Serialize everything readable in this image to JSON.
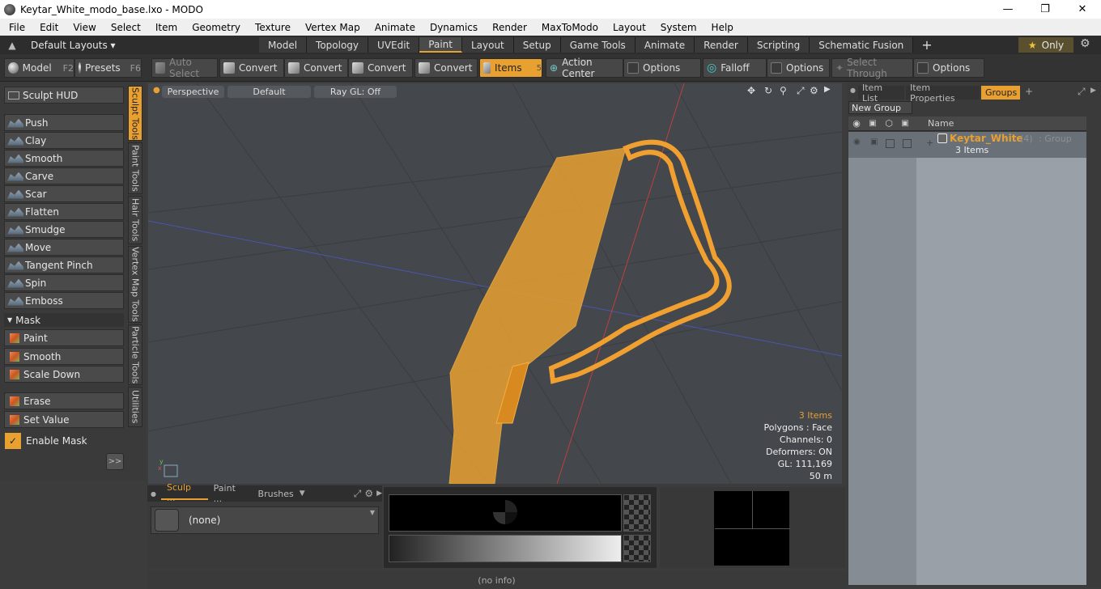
{
  "window": {
    "title": "Keytar_White_modo_base.lxo - MODO"
  },
  "menu": [
    "File",
    "Edit",
    "View",
    "Select",
    "Item",
    "Geometry",
    "Texture",
    "Vertex Map",
    "Animate",
    "Dynamics",
    "Render",
    "MaxToModo",
    "Layout",
    "System",
    "Help"
  ],
  "modebar": {
    "layouts_label": "Default Layouts ▾",
    "tabs": [
      "Model",
      "Topology",
      "UVEdit",
      "Paint",
      "Layout",
      "Setup",
      "Game Tools",
      "Animate",
      "Render",
      "Scripting",
      "Schematic Fusion"
    ],
    "active_tab": "Paint",
    "add": "+",
    "only_label": "Only",
    "star": "★"
  },
  "toolbar": {
    "model": "Model",
    "model_key": "F2",
    "presets": "Presets",
    "presets_key": "F6",
    "auto_select": "Auto Select",
    "convert1": "Convert",
    "convert2": "Convert",
    "convert3": "Convert",
    "convert4": "Convert",
    "items": "Items",
    "items_key": "5",
    "action_center": "Action Center",
    "options1": "Options",
    "falloff": "Falloff",
    "options2": "Options",
    "select_through": "Select Through",
    "options3": "Options"
  },
  "left": {
    "sculpt_hud": "Sculpt HUD",
    "tools": [
      "Push",
      "Clay",
      "Smooth",
      "Carve",
      "Scar",
      "Flatten",
      "Smudge",
      "Move",
      "Tangent Pinch",
      "Spin",
      "Emboss"
    ],
    "mask_label": "Mask",
    "mask_tools": [
      "Paint",
      "Smooth",
      "Scale Down"
    ],
    "erase": "Erase",
    "set_value": "Set Value",
    "enable_mask": "Enable Mask",
    "more": ">>",
    "vtabs": [
      "Sculpt Tools",
      "Paint Tools",
      "Hair Tools",
      "Vertex Map Tools",
      "Particle Tools",
      "Utilities"
    ]
  },
  "viewport": {
    "view": "Perspective",
    "shading": "Default",
    "raygl": "Ray GL: Off",
    "info": {
      "items": "3 Items",
      "polygons": "Polygons : Face",
      "channels": "Channels: 0",
      "deformers": "Deformers: ON",
      "gl": "GL: 111,169",
      "scale": "50 m"
    }
  },
  "bottom": {
    "tabs": [
      "Sculp ...",
      "Paint ...",
      "Brushes"
    ],
    "preset": "(none)"
  },
  "right": {
    "tabs": [
      "Item List",
      "Item Properties",
      "Groups"
    ],
    "active_tab": "Groups",
    "new_group": "New Group",
    "col_name": "Name",
    "group_name": "Keytar_White",
    "group_count": "(4)",
    "group_type": ": Group",
    "group_items": "3 Items"
  },
  "status": "(no info)",
  "colors": {
    "accent": "#e8a030",
    "mesh": "#f0a030"
  }
}
